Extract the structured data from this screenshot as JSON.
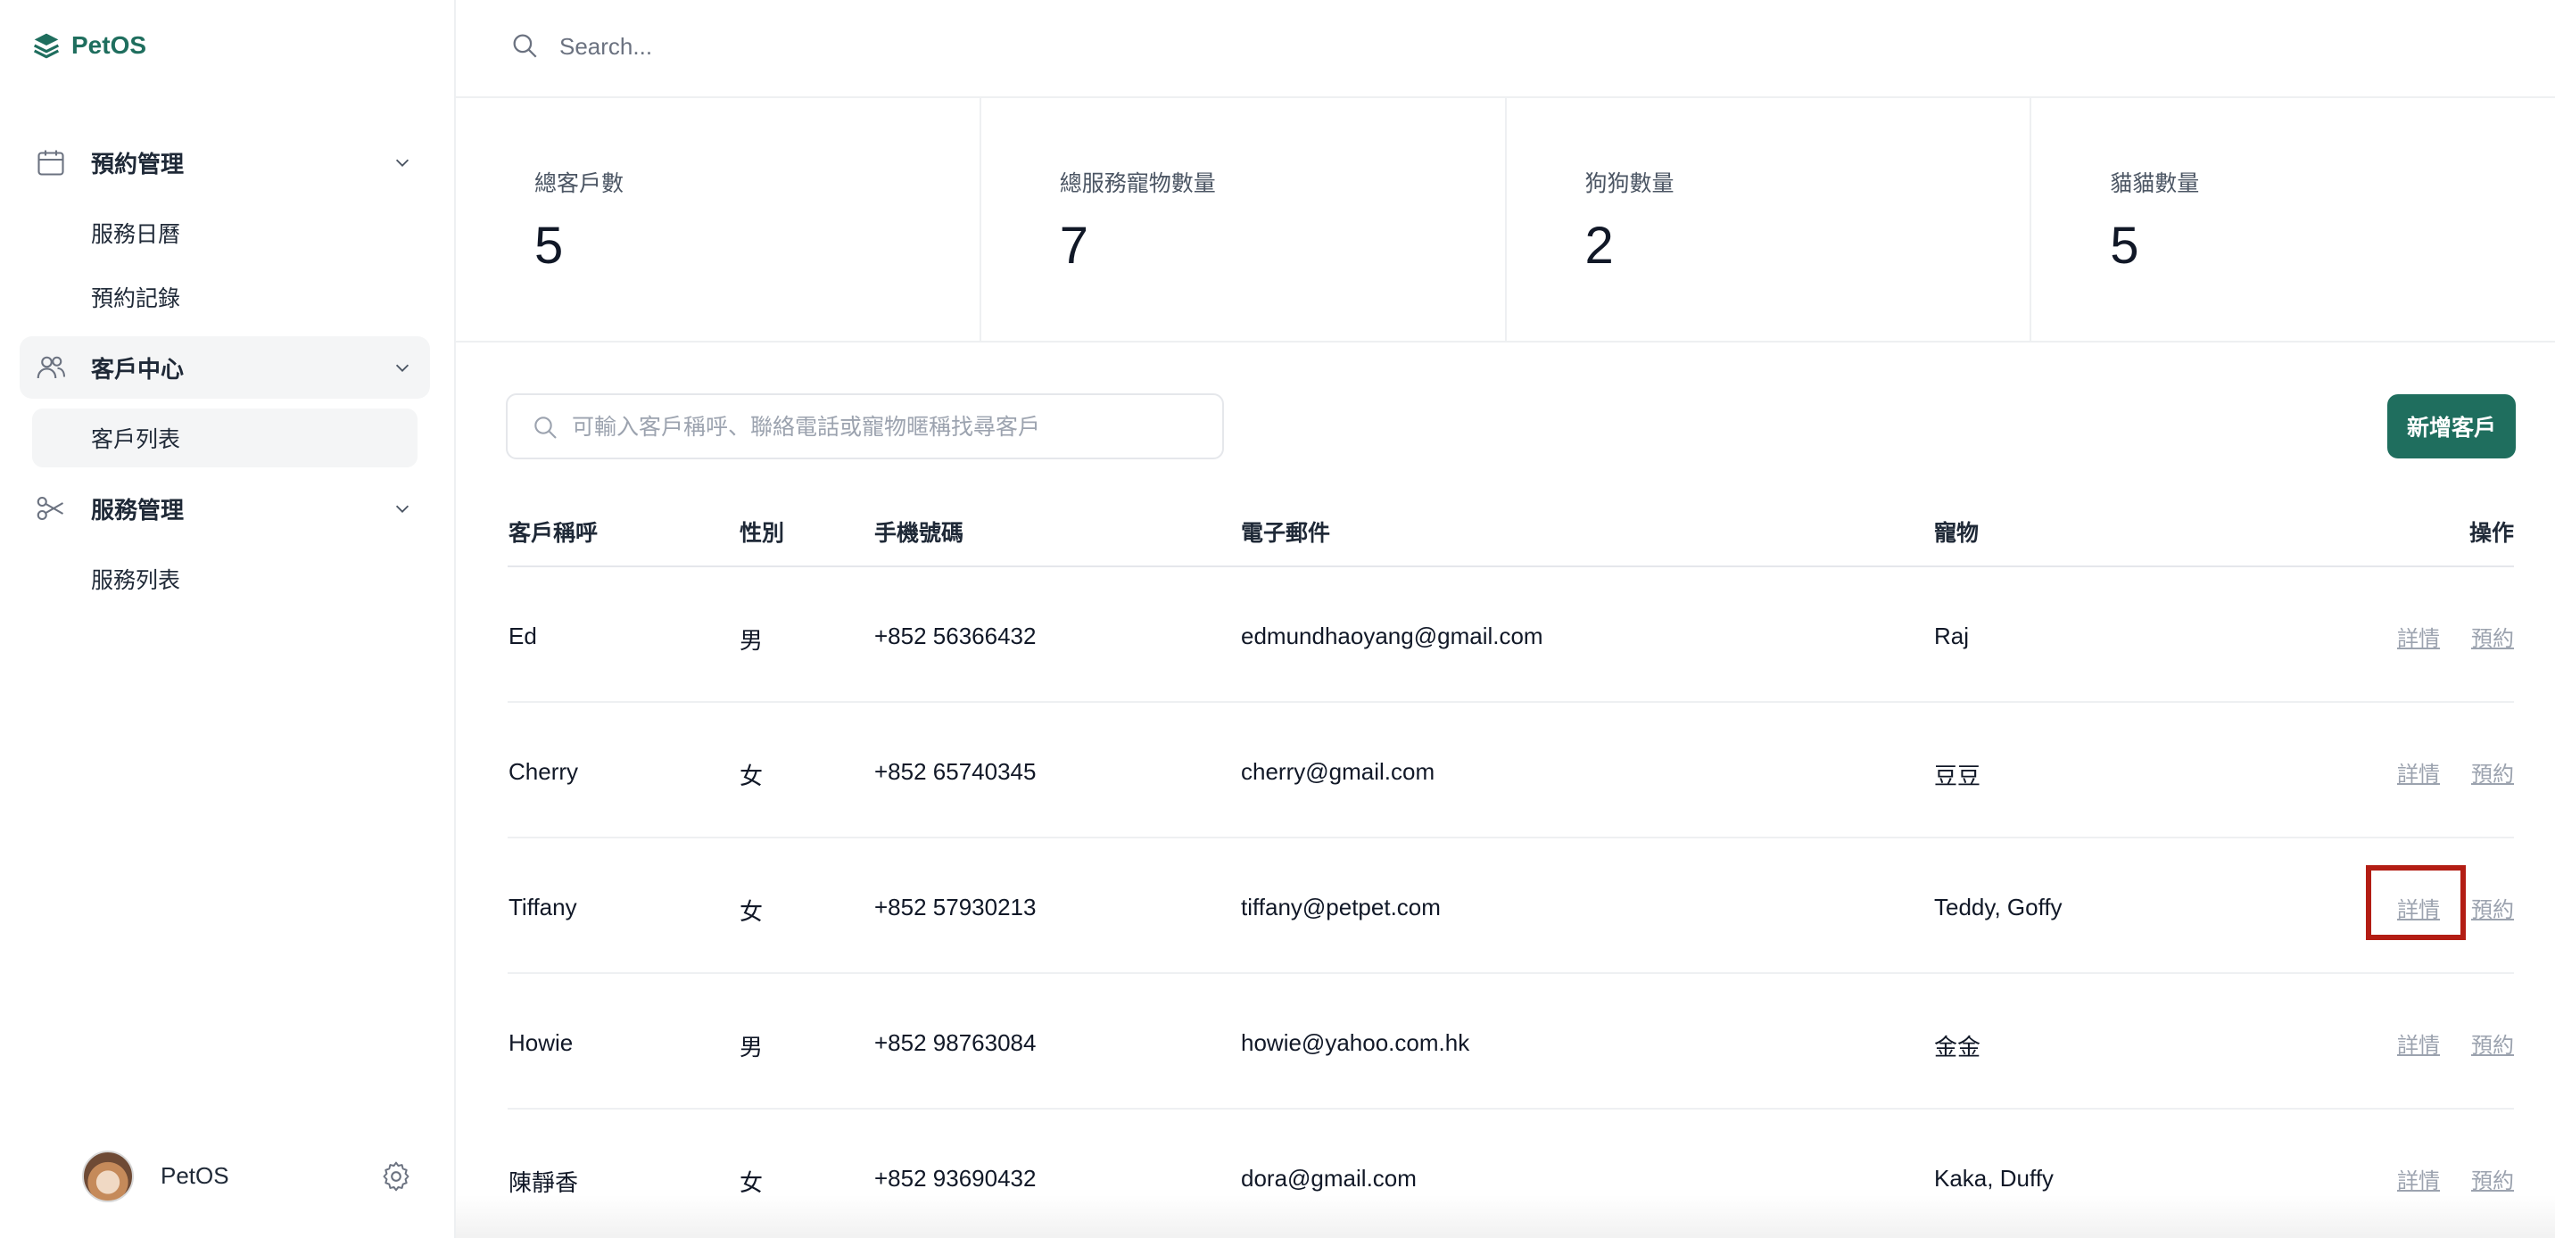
{
  "app": {
    "name": "PetOS"
  },
  "sidebar": {
    "groups": [
      {
        "label": "預約管理",
        "icon": "calendar-icon",
        "items": [
          {
            "label": "服務日曆"
          },
          {
            "label": "預約記錄"
          }
        ]
      },
      {
        "label": "客戶中心",
        "icon": "users-icon",
        "items": [
          {
            "label": "客戶列表"
          }
        ]
      },
      {
        "label": "服務管理",
        "icon": "scissors-icon",
        "items": [
          {
            "label": "服務列表"
          }
        ]
      }
    ],
    "user": {
      "name": "PetOS"
    }
  },
  "topbar": {
    "search_placeholder": "Search..."
  },
  "stats": [
    {
      "label": "總客戶數",
      "value": "5"
    },
    {
      "label": "總服務寵物數量",
      "value": "7"
    },
    {
      "label": "狗狗數量",
      "value": "2"
    },
    {
      "label": "貓貓數量",
      "value": "5"
    }
  ],
  "customers": {
    "search_placeholder": "可輸入客戶稱呼、聯絡電話或寵物暱稱找尋客戶",
    "add_button": "新增客戶",
    "columns": {
      "name": "客戶稱呼",
      "gender": "性別",
      "phone": "手機號碼",
      "email": "電子郵件",
      "pets": "寵物",
      "ops": "操作"
    },
    "rows": [
      {
        "name": "Ed",
        "gender": "男",
        "phone": "+852 56366432",
        "email": "edmundhaoyang@gmail.com",
        "pets": "Raj",
        "detail": "詳情",
        "book": "預約"
      },
      {
        "name": "Cherry",
        "gender": "女",
        "phone": "+852 65740345",
        "email": "cherry@gmail.com",
        "pets": "豆豆",
        "detail": "詳情",
        "book": "預約"
      },
      {
        "name": "Tiffany",
        "gender": "女",
        "phone": "+852 57930213",
        "email": "tiffany@petpet.com",
        "pets": "Teddy, Goffy",
        "detail": "詳情",
        "book": "預約"
      },
      {
        "name": "Howie",
        "gender": "男",
        "phone": "+852 98763084",
        "email": "howie@yahoo.com.hk",
        "pets": "金金",
        "detail": "詳情",
        "book": "預約"
      },
      {
        "name": "陳靜香",
        "gender": "女",
        "phone": "+852 93690432",
        "email": "dora@gmail.com",
        "pets": "Kaka, Duffy",
        "detail": "詳情",
        "book": "預約"
      }
    ]
  },
  "colors": {
    "brand": "#1f6e5e",
    "highlight": "#b31d14",
    "muted_link": "#9ca3af"
  }
}
